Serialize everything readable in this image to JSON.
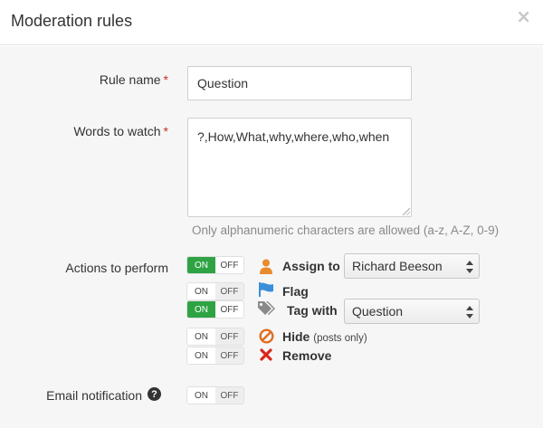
{
  "modal": {
    "title": "Moderation rules",
    "close_glyph": "×"
  },
  "form": {
    "rule_name": {
      "label": "Rule name",
      "required_mark": "*",
      "value": "Question"
    },
    "words_to_watch": {
      "label": "Words to watch",
      "required_mark": "*",
      "value": "?,How,What,why,where,who,when",
      "hint": "Only alphanumeric characters are allowed (a-z, A-Z, 0-9)"
    },
    "actions": {
      "label": "Actions to perform",
      "items": [
        {
          "name": "Assign to",
          "note": "",
          "icon": "user-icon",
          "state": "on",
          "on_label": "ON",
          "off_label": "OFF",
          "select_value": "Richard Beeson"
        },
        {
          "name": "Flag",
          "note": "",
          "icon": "flag-icon",
          "state": "off",
          "on_label": "ON",
          "off_label": "OFF"
        },
        {
          "name": "Tag with",
          "note": "",
          "icon": "tags-icon",
          "state": "on",
          "on_label": "ON",
          "off_label": "OFF",
          "select_value": "Question"
        },
        {
          "name": "Hide",
          "note": "(posts only)",
          "icon": "ban-icon",
          "state": "off",
          "on_label": "ON",
          "off_label": "OFF"
        },
        {
          "name": "Remove",
          "note": "",
          "icon": "remove-x-icon",
          "state": "off",
          "on_label": "ON",
          "off_label": "OFF"
        }
      ]
    },
    "email_notification": {
      "label": "Email notification",
      "help_glyph": "?",
      "state": "off",
      "on_label": "ON",
      "off_label": "OFF"
    }
  },
  "colors": {
    "toggle_on": "#2fa344",
    "required": "#c9302c",
    "user_icon": "#e98a2d",
    "flag_icon": "#3b8fd8",
    "ban_icon": "#e06d1f",
    "remove_icon": "#d9261c",
    "tags_icon": "#8a8a8a"
  }
}
